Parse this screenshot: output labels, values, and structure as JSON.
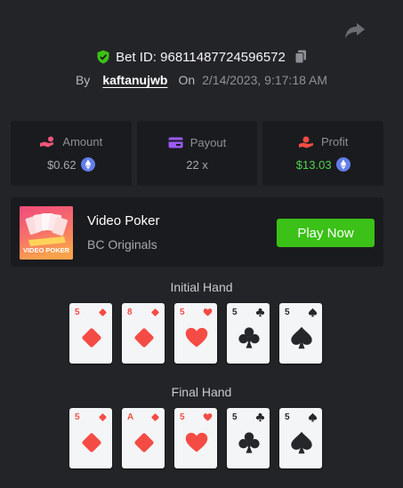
{
  "header": {
    "bet_id": "Bet ID: 96811487724596572",
    "by_label": "By",
    "username": "kaftanujwb",
    "on_label": "On",
    "datetime": "2/14/2023, 9:17:18 AM"
  },
  "stats": {
    "amount": {
      "label": "Amount",
      "value": "$0.62"
    },
    "payout": {
      "label": "Payout",
      "value": "22 x"
    },
    "profit": {
      "label": "Profit",
      "value": "$13.03"
    }
  },
  "game": {
    "thumb_label": "VIDEO POKER",
    "title": "Video Poker",
    "provider": "BC Originals",
    "play_label": "Play Now"
  },
  "hands": {
    "initial_title": "Initial Hand",
    "final_title": "Final Hand",
    "initial": [
      {
        "rank": "5",
        "suit": "diamond"
      },
      {
        "rank": "8",
        "suit": "diamond"
      },
      {
        "rank": "5",
        "suit": "heart"
      },
      {
        "rank": "5",
        "suit": "club"
      },
      {
        "rank": "5",
        "suit": "spade"
      }
    ],
    "final": [
      {
        "rank": "5",
        "suit": "diamond"
      },
      {
        "rank": "A",
        "suit": "diamond"
      },
      {
        "rank": "5",
        "suit": "heart"
      },
      {
        "rank": "5",
        "suit": "club"
      },
      {
        "rank": "5",
        "suit": "spade"
      }
    ]
  },
  "colors": {
    "background": "#232427",
    "panel": "#1a1b1e",
    "accent_green": "#3bc117",
    "profit_green": "#4fd34a",
    "red_suit": "#f44c45"
  }
}
